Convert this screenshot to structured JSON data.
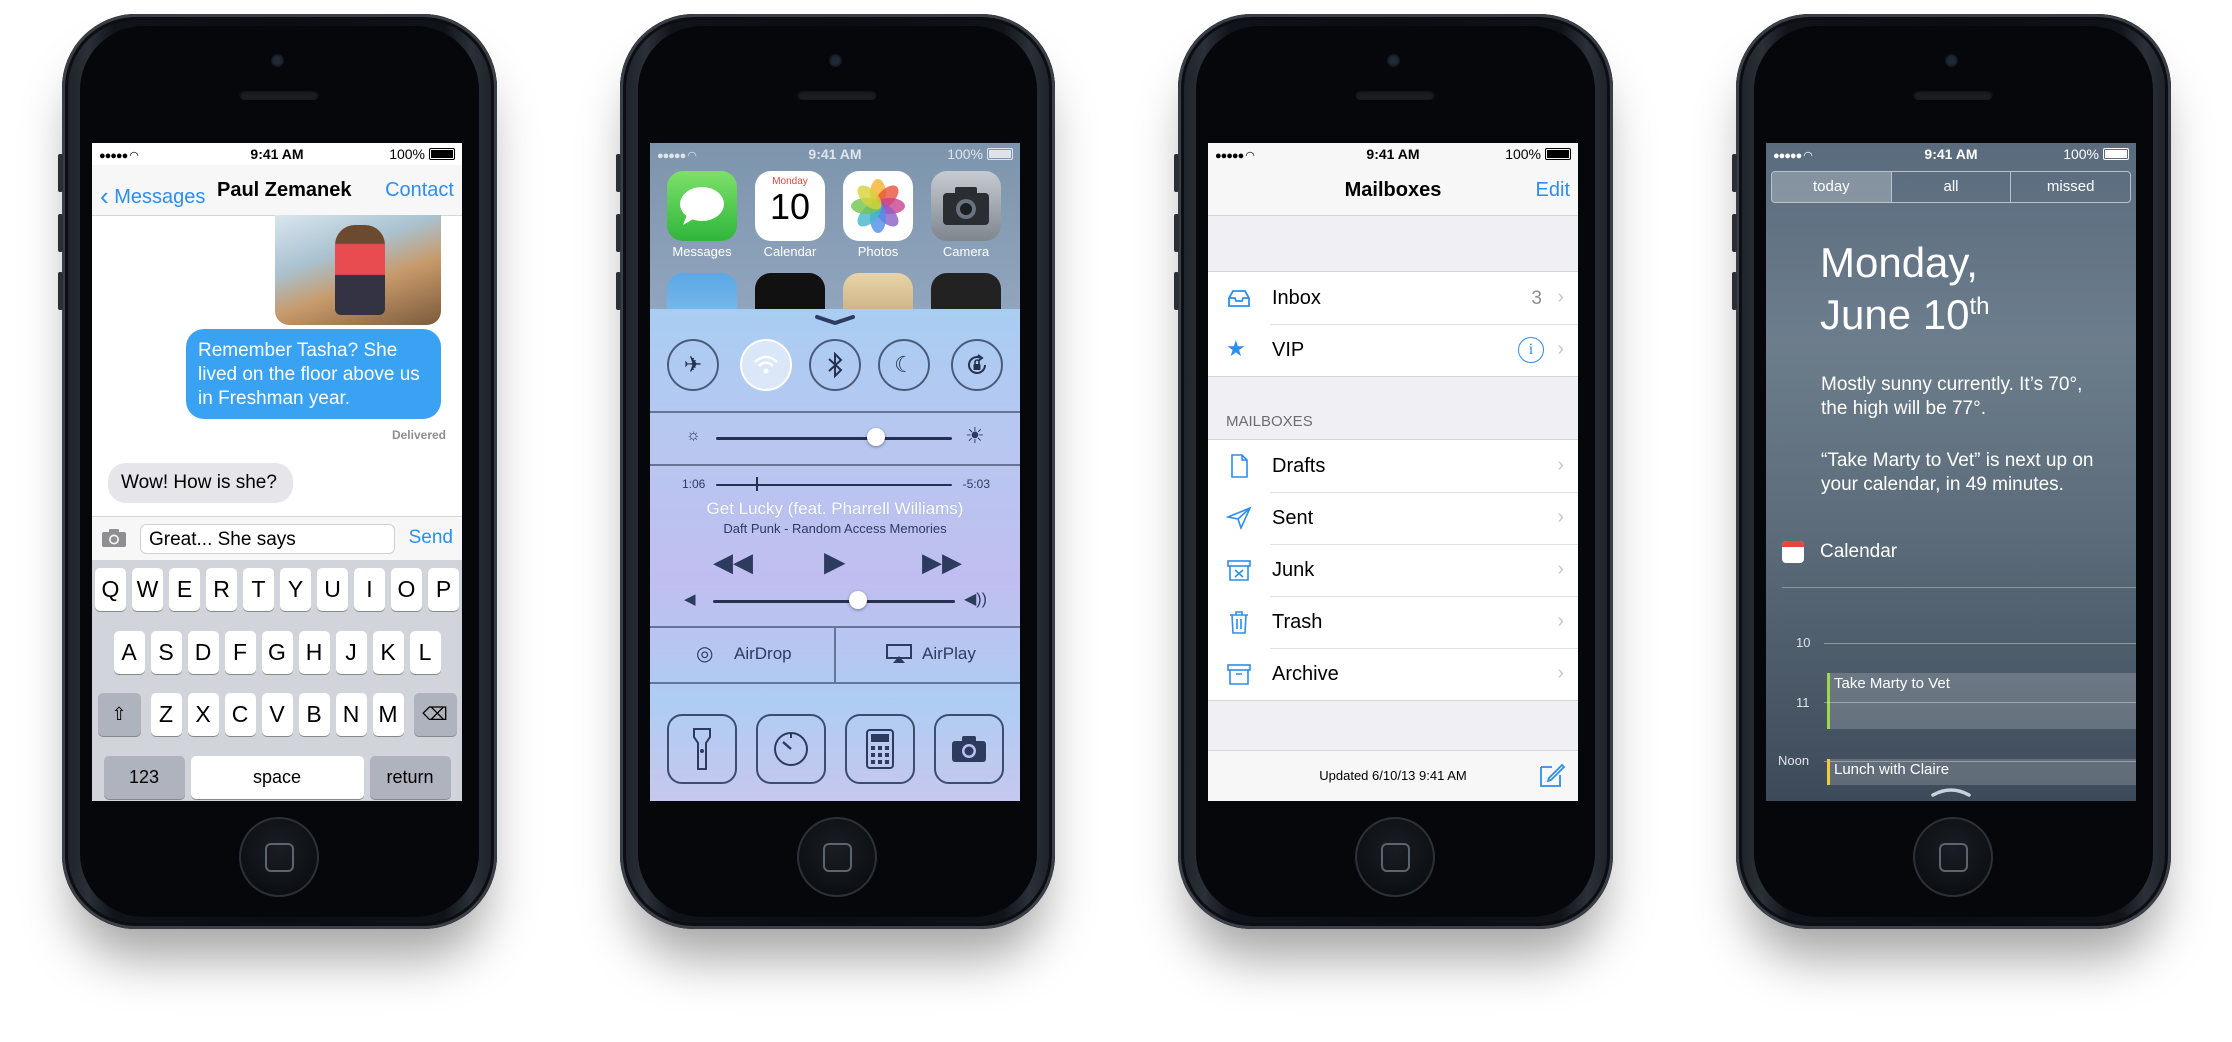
{
  "status": {
    "time": "9:41 AM",
    "battery": "100%"
  },
  "messages": {
    "back": "Messages",
    "title": "Paul Zemanek",
    "contact": "Contact",
    "outgoing": "Remember Tasha? She lived on the floor above us in Freshman year.",
    "delivered": "Delivered",
    "incoming": "Wow! How is she?",
    "draft": "Great... She says",
    "send": "Send",
    "keys_row1": [
      "Q",
      "W",
      "E",
      "R",
      "T",
      "Y",
      "U",
      "I",
      "O",
      "P"
    ],
    "keys_row2": [
      "A",
      "S",
      "D",
      "F",
      "G",
      "H",
      "J",
      "K",
      "L"
    ],
    "keys_row3": [
      "Z",
      "X",
      "C",
      "V",
      "B",
      "N",
      "M"
    ],
    "key_123": "123",
    "key_space": "space",
    "key_return": "return"
  },
  "control_center": {
    "apps": [
      {
        "label": "Messages"
      },
      {
        "label": "Calendar",
        "day": "Monday",
        "date": "10"
      },
      {
        "label": "Photos"
      },
      {
        "label": "Camera"
      }
    ],
    "elapsed": "1:06",
    "remaining": "-5:03",
    "song": "Get Lucky (feat. Pharrell Williams)",
    "artist": "Daft Punk - Random Access Memories",
    "airdrop": "AirDrop",
    "airplay": "AirPlay",
    "brightness_level": 0.68,
    "volume_level": 0.6,
    "playback_progress": 0.17,
    "toggles": {
      "airplane": false,
      "wifi": true,
      "bluetooth": false,
      "do_not_disturb": false,
      "rotation_lock": false
    }
  },
  "mail": {
    "title": "Mailboxes",
    "edit": "Edit",
    "inbox": "Inbox",
    "inbox_count": "3",
    "vip": "VIP",
    "section": "MAILBOXES",
    "folders": [
      "Drafts",
      "Sent",
      "Junk",
      "Trash",
      "Archive"
    ],
    "updated": "Updated 6/10/13 9:41 AM"
  },
  "notification_center": {
    "tabs": [
      "today",
      "all",
      "missed"
    ],
    "selected_tab": "today",
    "date_line1": "Monday,",
    "date_line2": "June 10",
    "date_suffix": "th",
    "weather": "Mostly sunny currently. It’s 70°, the high will be 77°.",
    "next": "“Take Marty to Vet” is next up on your calendar, in 49 minutes.",
    "calendar": "Calendar",
    "hours": [
      "10",
      "11",
      "Noon"
    ],
    "events": [
      "Take Marty to Vet",
      "Lunch with Claire"
    ]
  },
  "colors": {
    "ios_blue": "#2b8ef0",
    "bubble_blue": "#3aa2f2",
    "event_green": "#9fd84c",
    "event_yellow": "#f5c842"
  }
}
